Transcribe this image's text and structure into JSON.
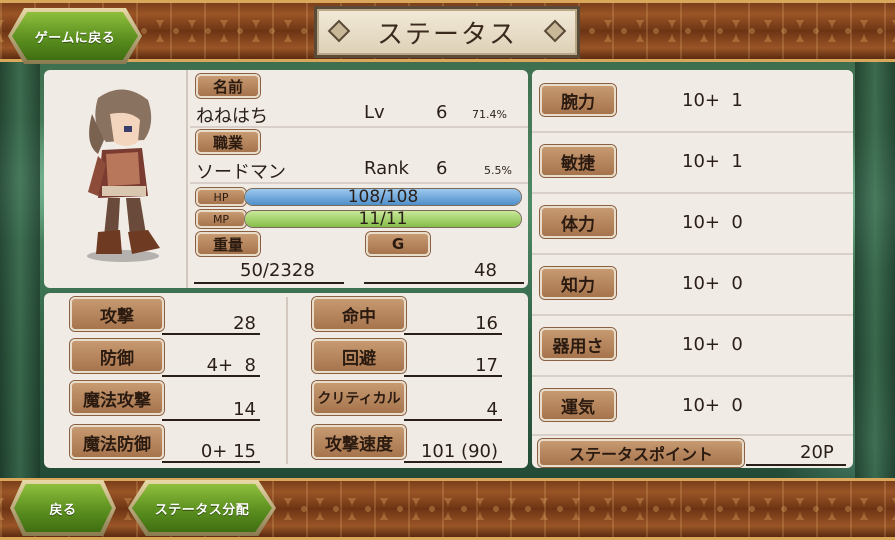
{
  "title": "ステータス",
  "buttons": {
    "back_to_game": "ゲームに戻る",
    "back": "戻る",
    "allocate": "ステータス分配"
  },
  "character": {
    "name_label": "名前",
    "name": "ねねはち",
    "lv_label": "Lv",
    "lv": "6",
    "lv_progress": "71.4%",
    "job_label": "職業",
    "job": "ソードマン",
    "rank_label": "Rank",
    "rank": "6",
    "rank_progress": "5.5%",
    "hp_label": "HP",
    "hp": "108/108",
    "hp_fraction": 1.0,
    "mp_label": "MP",
    "mp": "11/11",
    "mp_fraction": 1.0,
    "weight_label": "重量",
    "weight": "50/2328",
    "gold_label": "G",
    "gold": "48"
  },
  "combat": {
    "left": [
      {
        "label": "攻撃",
        "value": "28"
      },
      {
        "label": "防御",
        "value": "4+  8"
      },
      {
        "label": "魔法攻撃",
        "value": "14"
      },
      {
        "label": "魔法防御",
        "value": "0+ 15"
      }
    ],
    "right": [
      {
        "label": "命中",
        "value": "16"
      },
      {
        "label": "回避",
        "value": "17"
      },
      {
        "label": "クリティカル",
        "value": "4"
      },
      {
        "label": "攻撃速度",
        "value": "101 (90)"
      }
    ]
  },
  "stats": [
    {
      "label": "腕力",
      "value": "10+  1"
    },
    {
      "label": "敏捷",
      "value": "10+  1"
    },
    {
      "label": "体力",
      "value": "10+  0"
    },
    {
      "label": "知力",
      "value": "10+  0"
    },
    {
      "label": "器用さ",
      "value": "10+  0"
    },
    {
      "label": "運気",
      "value": "10+  0"
    }
  ],
  "status_points_label": "ステータスポイント",
  "status_points": "20P",
  "colors": {
    "hp_fill": "#5fa0d8",
    "mp_fill": "#9bcf5a",
    "label_bg": "#b88660",
    "panel_bg": "#f1ebe6"
  }
}
